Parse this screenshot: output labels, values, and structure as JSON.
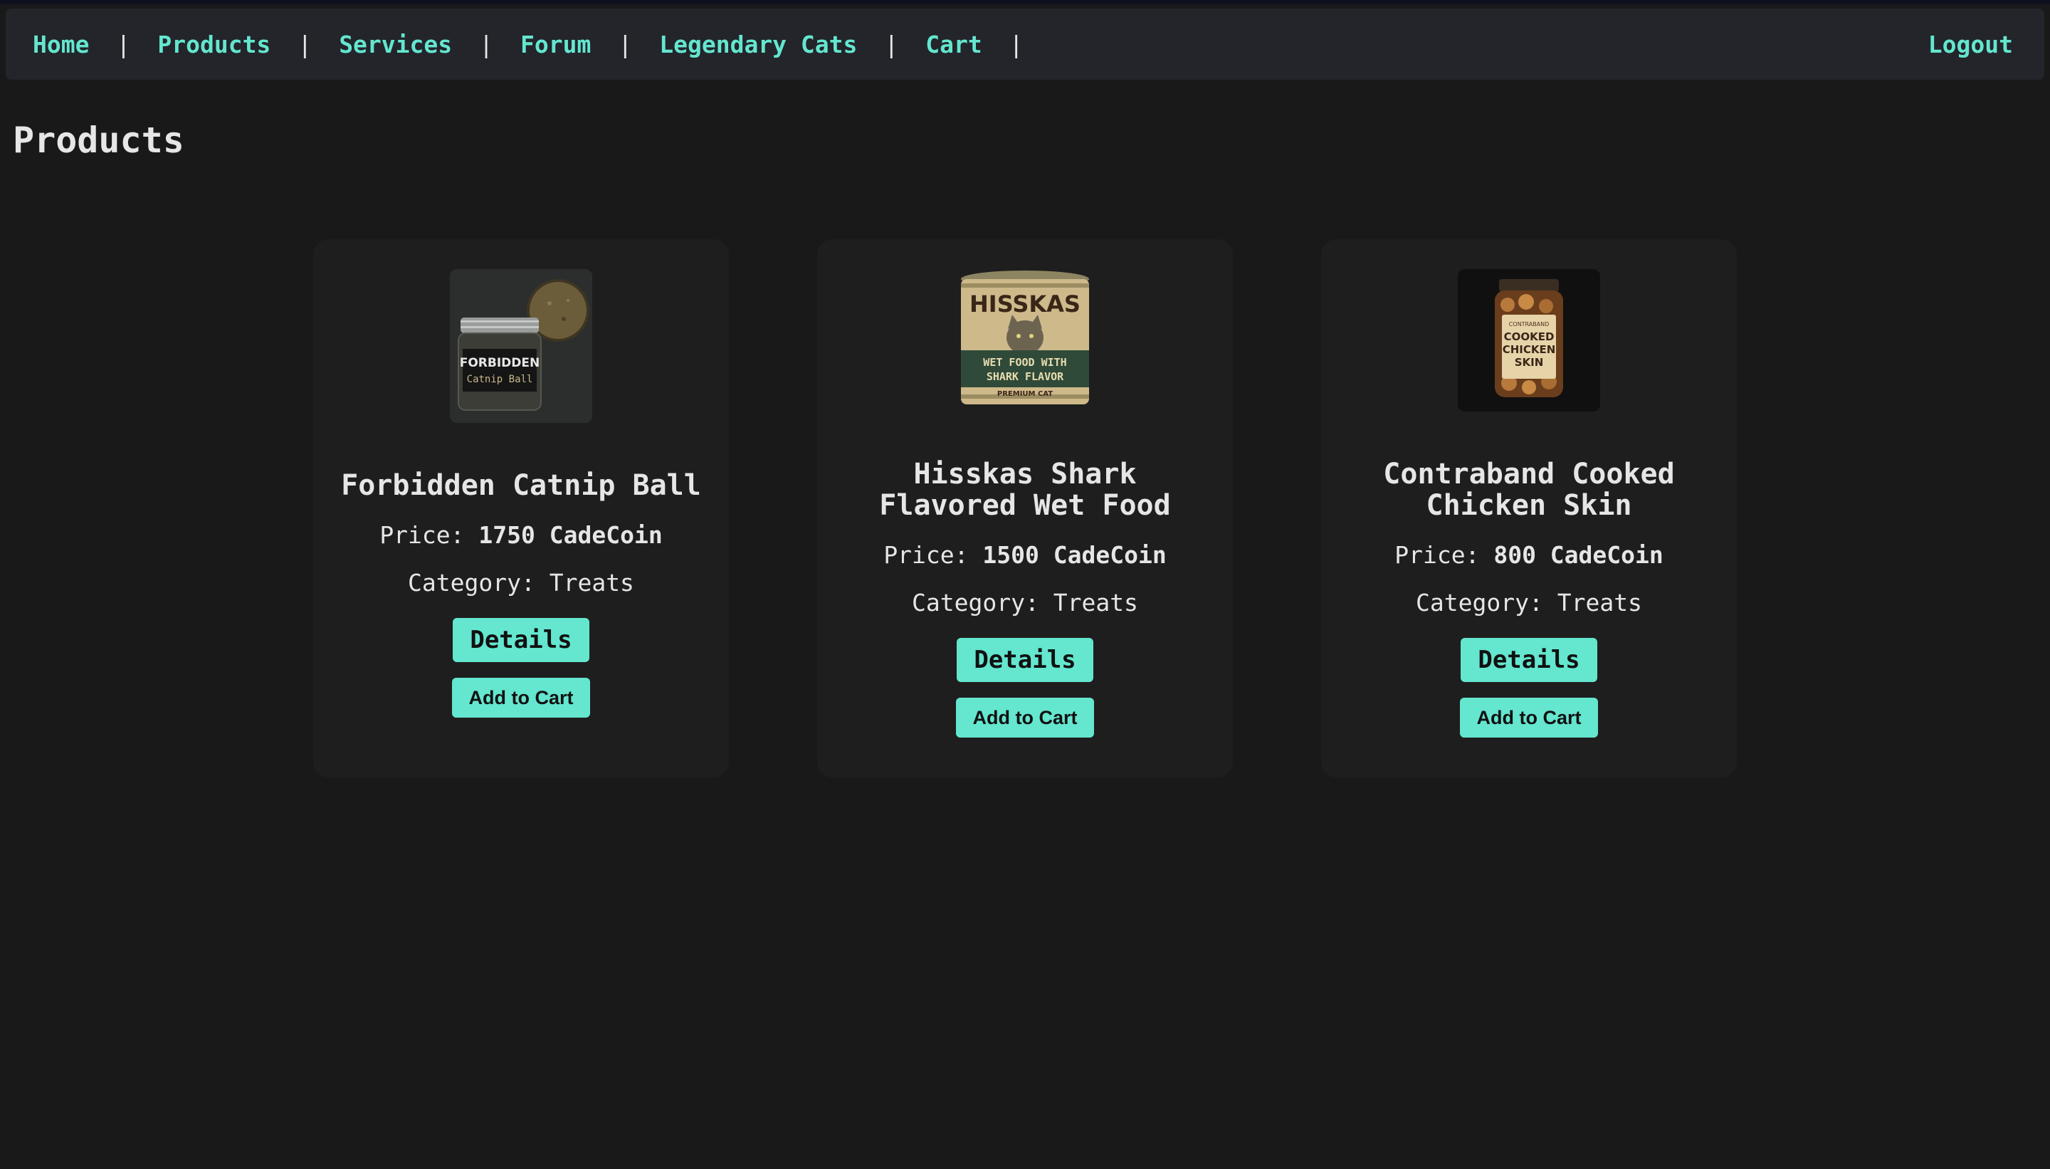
{
  "nav": {
    "links": [
      "Home",
      "Products",
      "Services",
      "Forum",
      "Legendary Cats",
      "Cart"
    ],
    "separator": "|",
    "logout": "Logout"
  },
  "page": {
    "title": "Products"
  },
  "products": [
    {
      "name": "Forbidden Catnip Ball",
      "price_label": "Price:",
      "price_value": "1750 CadeCoin",
      "category": "Category: Treats",
      "details_label": "Details",
      "cart_label": "Add to Cart",
      "image_icon": "catnip-jar-icon",
      "image_text": [
        "FORBIDDEN",
        "Catnip Ball"
      ]
    },
    {
      "name": "Hisskas Shark Flavored Wet Food",
      "price_label": "Price:",
      "price_value": "1500 CadeCoin",
      "category": "Category: Treats",
      "details_label": "Details",
      "cart_label": "Add to Cart",
      "image_icon": "cat-food-can-icon",
      "image_text": [
        "HISSKAS",
        "WET FOOD WITH",
        "SHARK FLAVOR",
        "PREMIUM CAT"
      ]
    },
    {
      "name": "Contraband Cooked Chicken Skin",
      "price_label": "Price:",
      "price_value": "800 CadeCoin",
      "category": "Category: Treats",
      "details_label": "Details",
      "cart_label": "Add to Cart",
      "image_icon": "chicken-skin-jar-icon",
      "image_text": [
        "CONTRABAND",
        "COOKED",
        "CHICKEN",
        "SKIN"
      ]
    }
  ],
  "colors": {
    "accent": "#64e6cf",
    "background": "#191919",
    "navbar": "#23252b",
    "card": "#1e1e1e"
  }
}
